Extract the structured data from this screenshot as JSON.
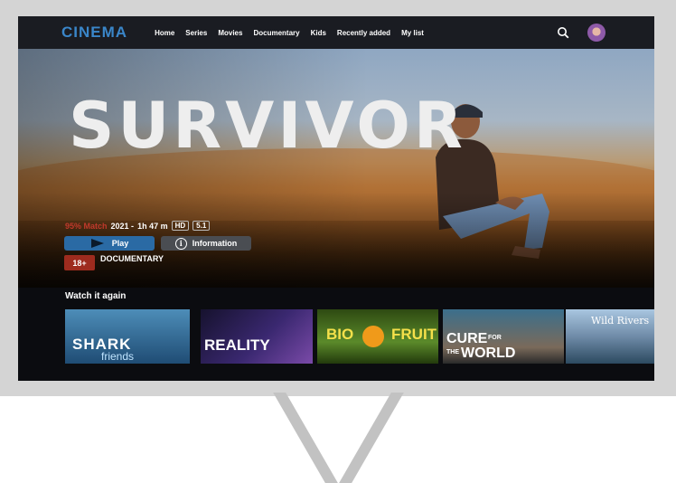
{
  "nav": {
    "logo": "CINEMA",
    "items": [
      "Home",
      "Series",
      "Movies",
      "Documentary",
      "Kids",
      "Recently added",
      "My list"
    ]
  },
  "hero": {
    "title": "SURVIVOR",
    "match": "95% Match",
    "year": "2021 -",
    "duration": "1h 47 m",
    "quality": "HD",
    "audio": "5.1",
    "play_label": "Play",
    "info_label": "Information",
    "rating": "18+",
    "genre": "DOCUMENTARY"
  },
  "row": {
    "title": "Watch it again",
    "tiles": [
      {
        "line1": "SHARK",
        "line2": "friends"
      },
      {
        "line1": "REALITY"
      },
      {
        "line1": "BIO",
        "line2": "FRUIT"
      },
      {
        "line1": "CURE",
        "line2": "FOR",
        "line3": "THE",
        "line4": "WORLD"
      },
      {
        "line1": "Wild Rivers"
      }
    ]
  },
  "icons": [
    "search-icon",
    "play-icon",
    "info-icon",
    "avatar"
  ],
  "colors": {
    "accent": "#2a6aa4",
    "match": "#c0392b",
    "rating": "#9e2b1e"
  }
}
